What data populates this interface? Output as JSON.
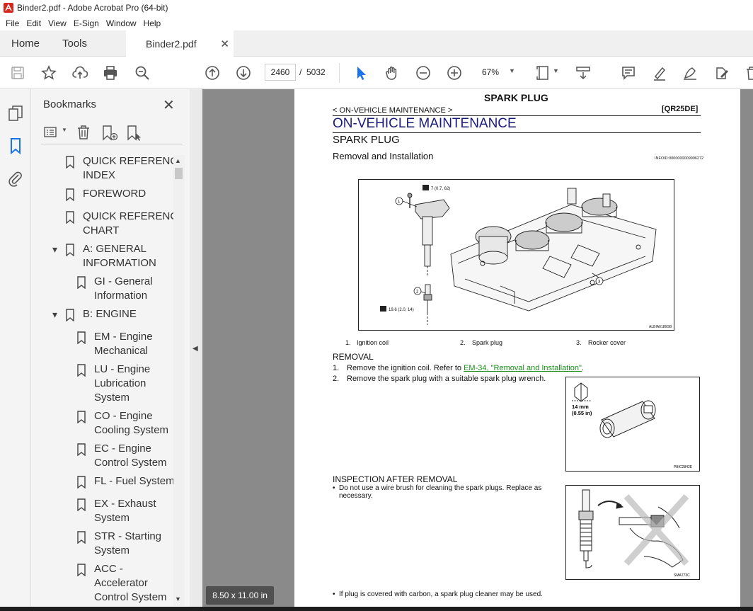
{
  "window": {
    "title": "Binder2.pdf - Adobe Acrobat Pro (64-bit)"
  },
  "menu": [
    "File",
    "Edit",
    "View",
    "E-Sign",
    "Window",
    "Help"
  ],
  "tabs": {
    "home": "Home",
    "tools": "Tools",
    "document": "Binder2.pdf"
  },
  "toolbar": {
    "current_page": "2460",
    "page_separator": "/",
    "total_pages": "5032",
    "zoom": "67%"
  },
  "bookmarks_panel": {
    "title": "Bookmarks",
    "items": [
      {
        "label": "QUICK REFERENCE INDEX",
        "line1": "QUICK REFERENCE",
        "line2": "INDEX"
      },
      {
        "label": "FOREWORD",
        "line1": "FOREWORD",
        "line2": ""
      },
      {
        "label": "QUICK REFERENCE CHART",
        "line1": "QUICK REFERENCE",
        "line2": "CHART"
      },
      {
        "label": "A: GENERAL INFORMATION",
        "line1": "A: GENERAL",
        "line2": "INFORMATION"
      },
      {
        "label": "GI - General Information",
        "line1": "GI - General",
        "line2": "Information"
      },
      {
        "label": "B: ENGINE",
        "line1": "B: ENGINE",
        "line2": ""
      },
      {
        "label": "EM - Engine Mechanical",
        "line1": "EM - Engine",
        "line2": "Mechanical"
      },
      {
        "label": "LU - Engine Lubrication System",
        "line1": "LU - Engine",
        "line2": "Lubrication",
        "line3": "System"
      },
      {
        "label": "CO - Engine Cooling System",
        "line1": "CO - Engine",
        "line2": "Cooling System"
      },
      {
        "label": "EC - Engine Control System",
        "line1": "EC - Engine",
        "line2": "Control System"
      },
      {
        "label": "FL - Fuel System",
        "line1": "FL - Fuel System",
        "line2": ""
      },
      {
        "label": "EX - Exhaust System",
        "line1": "EX - Exhaust",
        "line2": "System"
      },
      {
        "label": "STR - Starting System",
        "line1": "STR - Starting",
        "line2": "System"
      },
      {
        "label": "ACC - Accelerator Control System",
        "line1": "ACC -",
        "line2": "Accelerator",
        "line3": "Control System"
      }
    ]
  },
  "page_size": "8.50 x 11.00 in",
  "document": {
    "header_title": "SPARK PLUG",
    "breadcrumb": "< ON-VEHICLE MAINTENANCE >",
    "code": "[QR25DE]",
    "section_title": "ON-VEHICLE MAINTENANCE",
    "subtitle": "SPARK PLUG",
    "subsection": "Removal and Installation",
    "infoid": "INFOID:0000000009996272",
    "fig1": {
      "torque_top": "7 (0.7, 62)",
      "torque_bottom": "19.6 (2.0, 14)",
      "code": "ALBIA0186GB",
      "callouts": [
        "1",
        "2",
        "3"
      ]
    },
    "legend": [
      {
        "num": "1.",
        "text": "Ignition coil"
      },
      {
        "num": "2.",
        "text": "Spark plug"
      },
      {
        "num": "3.",
        "text": "Rocker cover"
      }
    ],
    "removal_heading": "REMOVAL",
    "step1_num": "1.",
    "step1_text": "Remove the ignition coil. Refer to ",
    "step1_link": "EM-34, \"Removal and Installation\"",
    "step1_end": ".",
    "step2_num": "2.",
    "step2_text": "Remove the spark plug with a suitable spark plug wrench.",
    "fig2": {
      "size_mm": "14 mm",
      "size_in": "(0.55 in)",
      "code": "PBIC2842E"
    },
    "inspection_heading": "INSPECTION AFTER REMOVAL",
    "bullet1_line1": "Do not use a wire brush for cleaning the spark plugs. Replace as",
    "bullet1_line2": "necessary.",
    "fig3": {
      "code": "SMA773C"
    },
    "bullet2": "If plug is covered with carbon, a spark plug cleaner may be used."
  },
  "colors": {
    "link": "#1a8c1a",
    "section_title": "#1a1a7a",
    "toolbar_icon": "#555555"
  }
}
